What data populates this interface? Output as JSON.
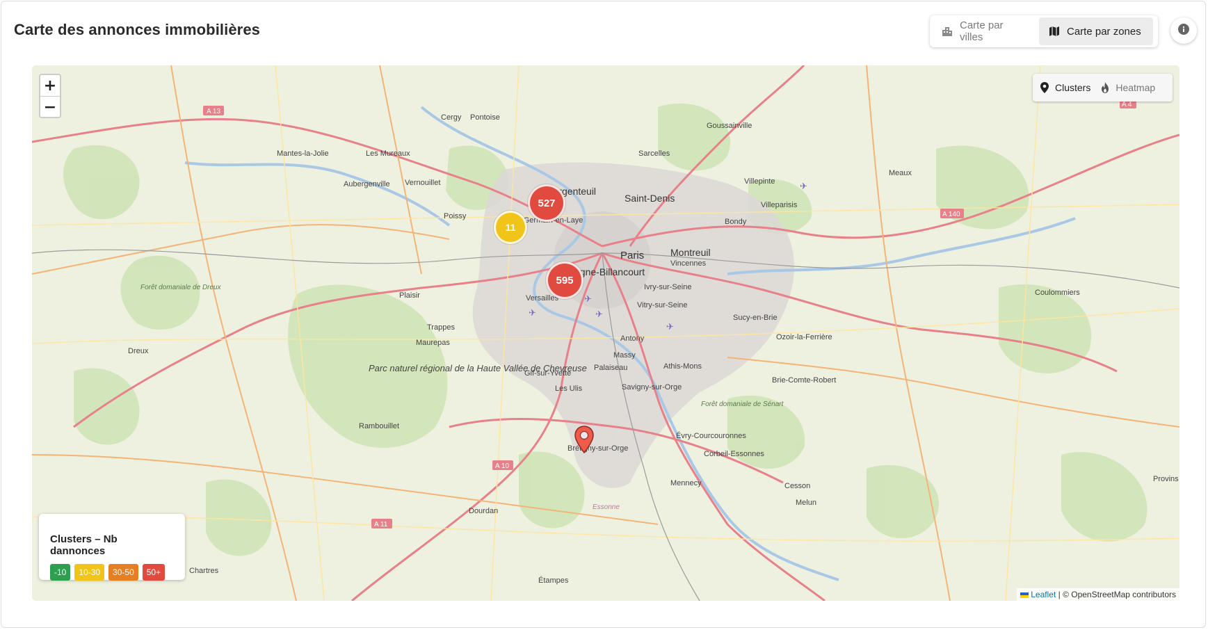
{
  "header": {
    "title": "Carte des annonces immobilières",
    "view_toggle": [
      {
        "label": "Carte par villes",
        "icon": "city-icon",
        "active": false
      },
      {
        "label": "Carte par zones",
        "icon": "map-icon",
        "active": true
      }
    ],
    "info_icon": "info-icon"
  },
  "map": {
    "zoom_in": "+",
    "zoom_out": "−",
    "layer_toggle": [
      {
        "label": "Clusters",
        "icon": "map-pin-icon",
        "active": true
      },
      {
        "label": "Heatmap",
        "icon": "flame-icon",
        "active": false
      }
    ],
    "clusters": [
      {
        "count": "527",
        "color": "#e04a3f"
      },
      {
        "count": "11",
        "color": "#f0c419"
      },
      {
        "count": "595",
        "color": "#e04a3f"
      }
    ],
    "marker_color": "#ef5b4b",
    "place_labels": {
      "paris": "Paris",
      "boulogne": "Boulogne-Billancourt",
      "saint_denis": "Saint-Denis",
      "argenteuil": "Argenteuil",
      "montreuil": "Montreuil",
      "versailles": "Versailles",
      "massy": "Massy",
      "antony": "Antony",
      "palaiseau": "Palaiseau",
      "rambouillet": "Rambouillet",
      "dourdan": "Dourdan",
      "etampes": "Étampes",
      "mennecy": "Mennecy",
      "melun": "Melun",
      "cesson": "Cesson",
      "meaux": "Meaux",
      "coulommiers": "Coulommiers",
      "villeparisis": "Villeparisis",
      "ozoir": "Ozoir-la-Ferrière",
      "brie": "Brie-Comte-Robert",
      "evry": "Évry-Courcouronnes",
      "bretigny": "Brétigny-sur-Orge",
      "trappes": "Trappes",
      "maurepas": "Maurepas",
      "plaisir": "Plaisir",
      "poissy": "Poissy",
      "pontoise": "Pontoise",
      "cergy": "Cergy",
      "mantes": "Mantes-la-Jolie",
      "aubergenville": "Aubergenville",
      "les_mureaux": "Les Mureaux",
      "vernouillet": "Vernouillet",
      "dreux": "Dreux",
      "sarcelles": "Sarcelles",
      "goussainville": "Goussainville",
      "villepinte": "Villepinte",
      "bondy": "Bondy",
      "vincennes": "Vincennes",
      "creteil": "Sucy-en-Brie",
      "ivry": "Ivry-sur-Seine",
      "vitry": "Vitry-sur-Seine",
      "athis": "Athis-Mons",
      "savigny": "Savigny-sur-Orge",
      "corbeil": "Corbeil-Essonnes",
      "saint_germain": "Saint-Germain-en-Laye",
      "gif": "Gif-sur-Yvette",
      "les_ulis": "Les Ulis",
      "chartres": "Chartres",
      "parc": "Parc naturel régional de la Haute Vallée de Chevreuse",
      "foret_dreux": "Forêt domaniale de Dreux",
      "foret_senart": "Forêt domaniale de Sénart",
      "essonne": "Essonne",
      "provins": "Provins"
    },
    "road_labels": [
      "A 13",
      "A 10",
      "A 11",
      "A 140",
      "A 4"
    ]
  },
  "legend": {
    "title": "Clusters – Nb dannonces",
    "items": [
      {
        "label": "-10",
        "color": "#2e9e4f"
      },
      {
        "label": "10-30",
        "color": "#f0c419"
      },
      {
        "label": "30-50",
        "color": "#e67e22"
      },
      {
        "label": "50+",
        "color": "#e04a3f"
      }
    ]
  },
  "attribution": {
    "leaflet": "Leaflet",
    "rest": "| © OpenStreetMap contributors"
  }
}
